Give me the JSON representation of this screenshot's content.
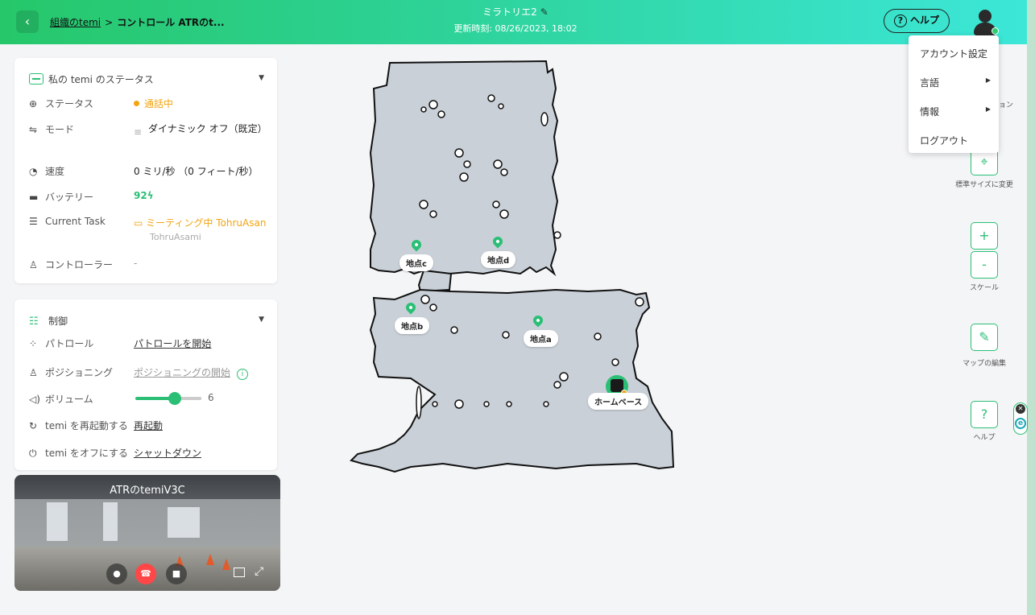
{
  "header": {
    "breadcrumb_link": "組織のtemi",
    "breadcrumb_sep": ">",
    "breadcrumb_current": "コントロール ATRのt...",
    "map_name": "ミラトリエ2",
    "updated": "更新時刻: 08/26/2023, 18:02",
    "help_label": "ヘルプ"
  },
  "account_menu": {
    "items": [
      {
        "label": "アカウント設定",
        "submenu": false
      },
      {
        "label": "言語",
        "submenu": true
      },
      {
        "label": "情報",
        "submenu": true
      },
      {
        "label": "ログアウト",
        "submenu": false
      }
    ]
  },
  "status_panel": {
    "title": "私の temi のステータス",
    "rows": [
      {
        "label": "ステータス",
        "value": "通話中"
      },
      {
        "label": "モード",
        "value": "ダイナミック オフ（既定）"
      },
      {
        "label": "速度",
        "value": "0 ミリ/秒 （0 フィート/秒）"
      },
      {
        "label": "バッテリー",
        "value": "92"
      },
      {
        "label": "Current Task",
        "value": "ミーティング中 TohruAsan",
        "sub": "TohruAsami"
      },
      {
        "label": "コントローラー",
        "value": "-"
      }
    ]
  },
  "control_panel": {
    "title": "制御",
    "patrol_label": "パトロール",
    "patrol_action": "パトロールを開始",
    "positioning_label": "ポジショニング",
    "positioning_action": "ポジショニングの開始",
    "volume_label": "ボリューム",
    "volume_value": "6",
    "volume_level": 0.6,
    "restart_label": "temi を再起動する",
    "restart_action": "再起動",
    "shutdown_label": "temi をオフにする",
    "shutdown_action": "シャットダウン"
  },
  "video": {
    "title": "ATRのtemiV3C"
  },
  "map": {
    "locations": [
      "地点c",
      "地点d",
      "地点b",
      "地点a"
    ],
    "home_base": "ホームベース"
  },
  "tools": {
    "reset_size_label": "標準サイズに変更",
    "zoom_in": "+",
    "zoom_out": "-",
    "scale_label": "スケール",
    "edit_map_label": "マップの編集",
    "help_tool": "?",
    "help_tool_label": "ヘルプ",
    "partial_label": "ョン"
  },
  "colors": {
    "accent_green": "#2bbf75",
    "status_orange": "#f2a411",
    "map_fill": "#c9d0d8"
  }
}
